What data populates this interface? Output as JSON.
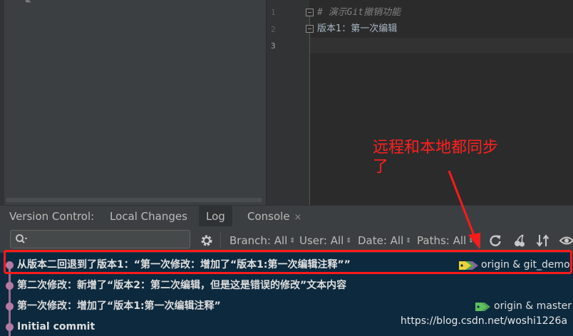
{
  "editor": {
    "line_numbers": [
      "1",
      "2",
      "3"
    ],
    "lines": [
      "# 演示Git撤销功能",
      "版本1：第一次编辑",
      ""
    ]
  },
  "annotation": {
    "text_line1": "远程和本地都同步",
    "text_line2": "了",
    "color": "#ff2020"
  },
  "tool_window": {
    "tabs": [
      {
        "label": "Version Control:"
      },
      {
        "label": "Local Changes"
      },
      {
        "label": "Log"
      },
      {
        "label": "Console",
        "close": "×"
      }
    ],
    "toolbar": {
      "search_placeholder": "",
      "filters": [
        {
          "label": "Branch: All"
        },
        {
          "label": "User: All"
        },
        {
          "label": "Date: All"
        },
        {
          "label": "Paths: All"
        }
      ],
      "icons": [
        "search-icon",
        "gear-icon",
        "refresh-icon",
        "cherry-pick-icon",
        "sort-icon",
        "eye-icon"
      ]
    }
  },
  "log": {
    "commits": [
      {
        "message": "从版本二回退到了版本1：“第一次修改：增加了“版本1:第一次编辑注释””",
        "refs": "origin & git_demo"
      },
      {
        "message": "第二次修改：新增了“版本2：第二次编辑，但是这是错误的修改”文本内容",
        "refs": ""
      },
      {
        "message": "第一次修改：增加了“版本1:第一次编辑注释”",
        "refs": "origin & master"
      },
      {
        "message": "Initial commit",
        "refs": ""
      }
    ]
  },
  "watermark": "https://blog.csdn.net/woshi1226a",
  "colors": {
    "log_bg": "#0d293e",
    "highlight": "#ff1a1a",
    "graph": "#b57aa3"
  }
}
